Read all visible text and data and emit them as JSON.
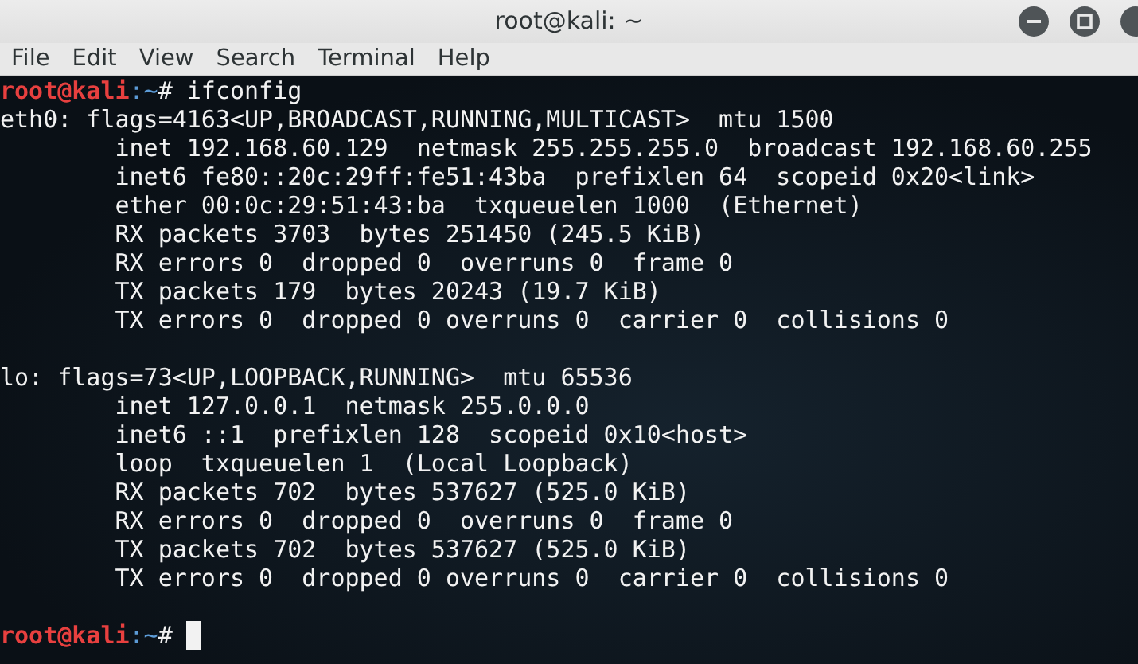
{
  "window": {
    "title": "root@kali: ~"
  },
  "menu": [
    "File",
    "Edit",
    "View",
    "Search",
    "Terminal",
    "Help"
  ],
  "terminal": {
    "lines": [
      {
        "kind": "prompt",
        "user_host": "root@kali",
        "path": ":~",
        "symbol": "#",
        "command": "ifconfig"
      },
      {
        "kind": "output",
        "text": "eth0: flags=4163<UP,BROADCAST,RUNNING,MULTICAST>  mtu 1500"
      },
      {
        "kind": "output",
        "text": "        inet 192.168.60.129  netmask 255.255.255.0  broadcast 192.168.60.255"
      },
      {
        "kind": "output",
        "text": "        inet6 fe80::20c:29ff:fe51:43ba  prefixlen 64  scopeid 0x20<link>"
      },
      {
        "kind": "output",
        "text": "        ether 00:0c:29:51:43:ba  txqueuelen 1000  (Ethernet)"
      },
      {
        "kind": "output",
        "text": "        RX packets 3703  bytes 251450 (245.5 KiB)"
      },
      {
        "kind": "output",
        "text": "        RX errors 0  dropped 0  overruns 0  frame 0"
      },
      {
        "kind": "output",
        "text": "        TX packets 179  bytes 20243 (19.7 KiB)"
      },
      {
        "kind": "output",
        "text": "        TX errors 0  dropped 0 overruns 0  carrier 0  collisions 0"
      },
      {
        "kind": "blank"
      },
      {
        "kind": "output",
        "text": "lo: flags=73<UP,LOOPBACK,RUNNING>  mtu 65536"
      },
      {
        "kind": "output",
        "text": "        inet 127.0.0.1  netmask 255.0.0.0"
      },
      {
        "kind": "output",
        "text": "        inet6 ::1  prefixlen 128  scopeid 0x10<host>"
      },
      {
        "kind": "output",
        "text": "        loop  txqueuelen 1  (Local Loopback)"
      },
      {
        "kind": "output",
        "text": "        RX packets 702  bytes 537627 (525.0 KiB)"
      },
      {
        "kind": "output",
        "text": "        RX errors 0  dropped 0  overruns 0  frame 0"
      },
      {
        "kind": "output",
        "text": "        TX packets 702  bytes 537627 (525.0 KiB)"
      },
      {
        "kind": "output",
        "text": "        TX errors 0  dropped 0 overruns 0  carrier 0  collisions 0"
      },
      {
        "kind": "blank"
      },
      {
        "kind": "prompt",
        "user_host": "root@kali",
        "path": ":~",
        "symbol": "#",
        "cursor": true
      }
    ]
  }
}
